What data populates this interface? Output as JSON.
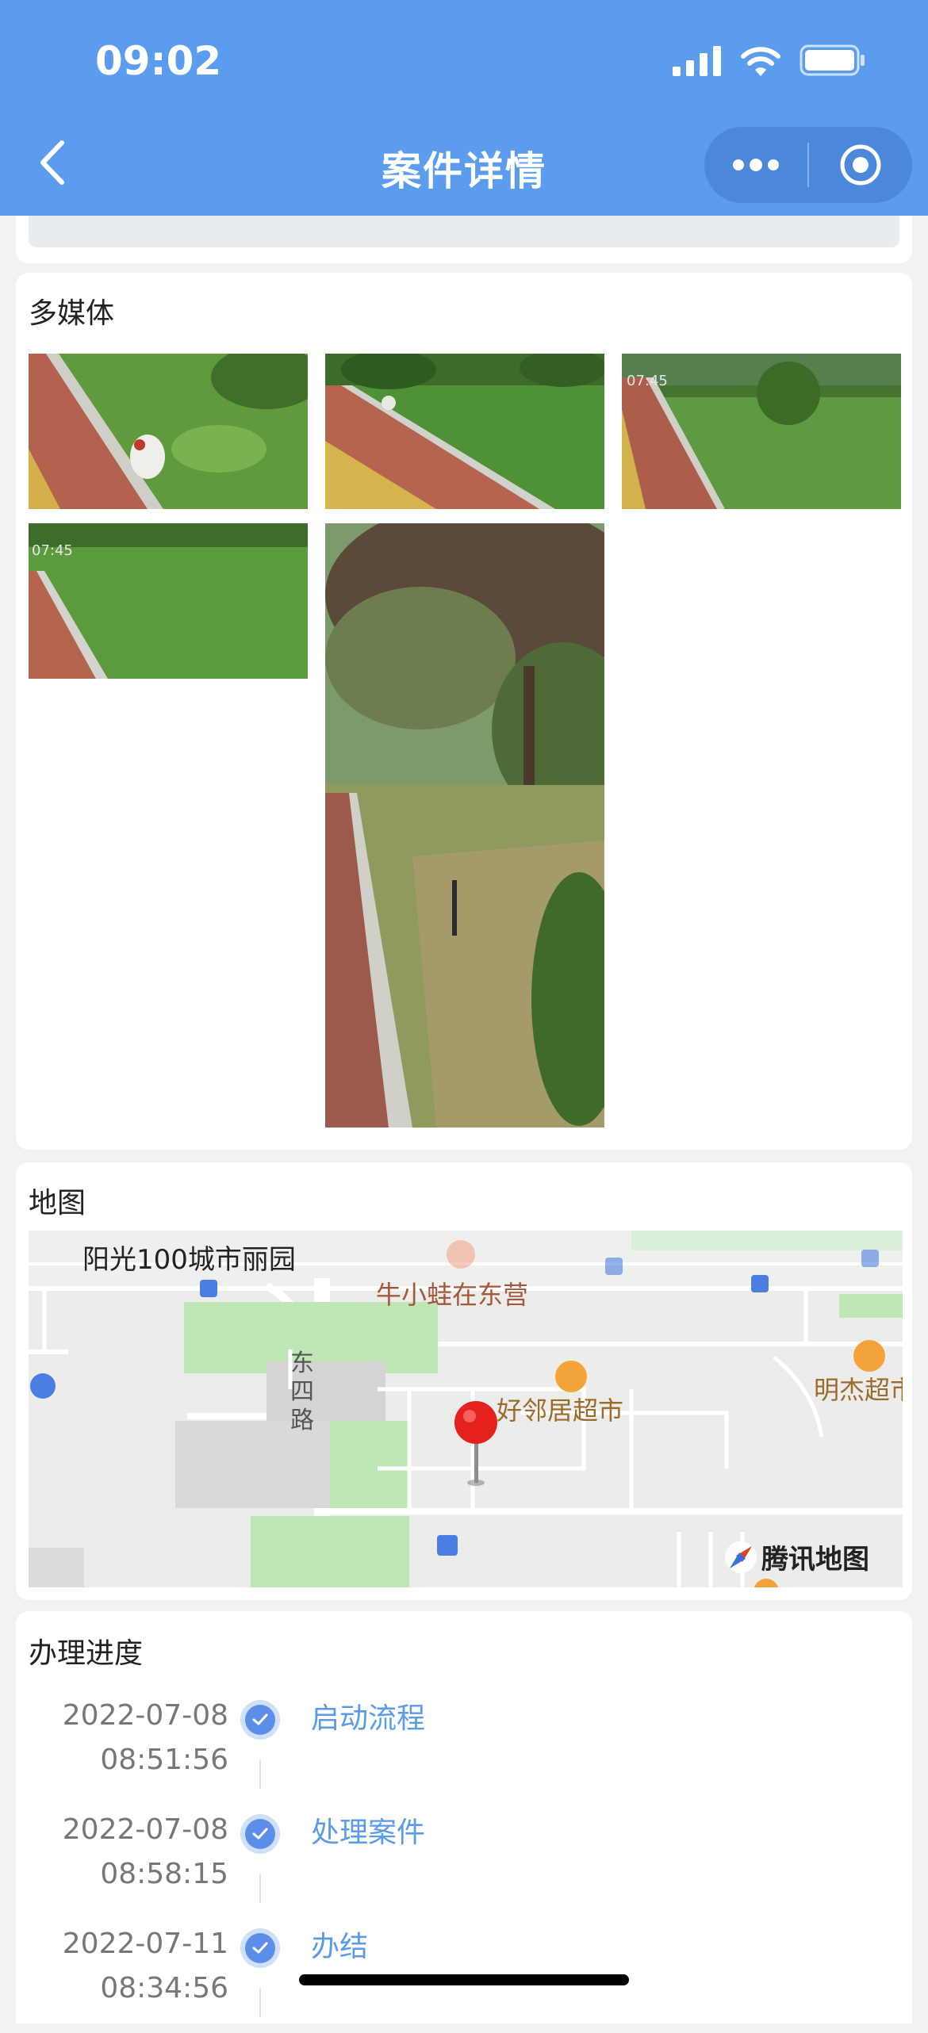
{
  "status_bar": {
    "time": "09:02"
  },
  "nav": {
    "title": "案件详情"
  },
  "media": {
    "title": "多媒体",
    "photo_watermark": "07:45"
  },
  "map": {
    "title": "地图",
    "labels": {
      "community": "阳光100城市丽园",
      "shop1": "牛小蛙在东营",
      "road": "东四路",
      "supermarket1": "好邻居超市",
      "supermarket2": "明杰超市",
      "provider": "腾讯地图"
    }
  },
  "progress": {
    "title": "办理进度",
    "steps": [
      {
        "date": "2022-07-08",
        "time": "08:51:56",
        "label": "启动流程"
      },
      {
        "date": "2022-07-08",
        "time": "08:58:15",
        "label": "处理案件"
      },
      {
        "date": "2022-07-11",
        "time": "08:34:56",
        "label": "办结"
      }
    ]
  },
  "colors": {
    "header": "#5b9cee",
    "accent": "#5b9ae6",
    "check": "#5b8ee6"
  }
}
